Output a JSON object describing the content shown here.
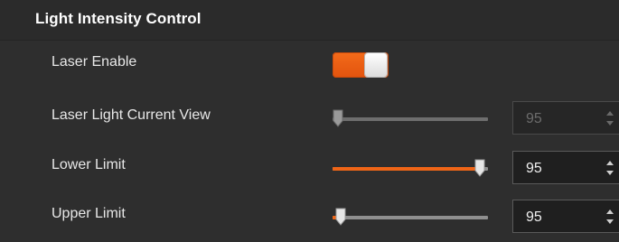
{
  "section": {
    "title": "Light Intensity Control"
  },
  "controls": {
    "laser_enable": {
      "label": "Laser Enable",
      "enabled": true,
      "accent": "#ef6517"
    },
    "laser_light_current_view": {
      "label": "Laser Light Current View",
      "value": "95",
      "slider_fraction": 0.0,
      "disabled": true
    },
    "lower_limit": {
      "label": "Lower Limit",
      "value": "95",
      "slider_fraction": 0.95
    },
    "upper_limit": {
      "label": "Upper Limit",
      "value": "95",
      "slider_fraction": 0.05
    }
  },
  "colors": {
    "accent": "#ef6517",
    "background": "#2e2e2e",
    "text": "#e8e8e8"
  }
}
